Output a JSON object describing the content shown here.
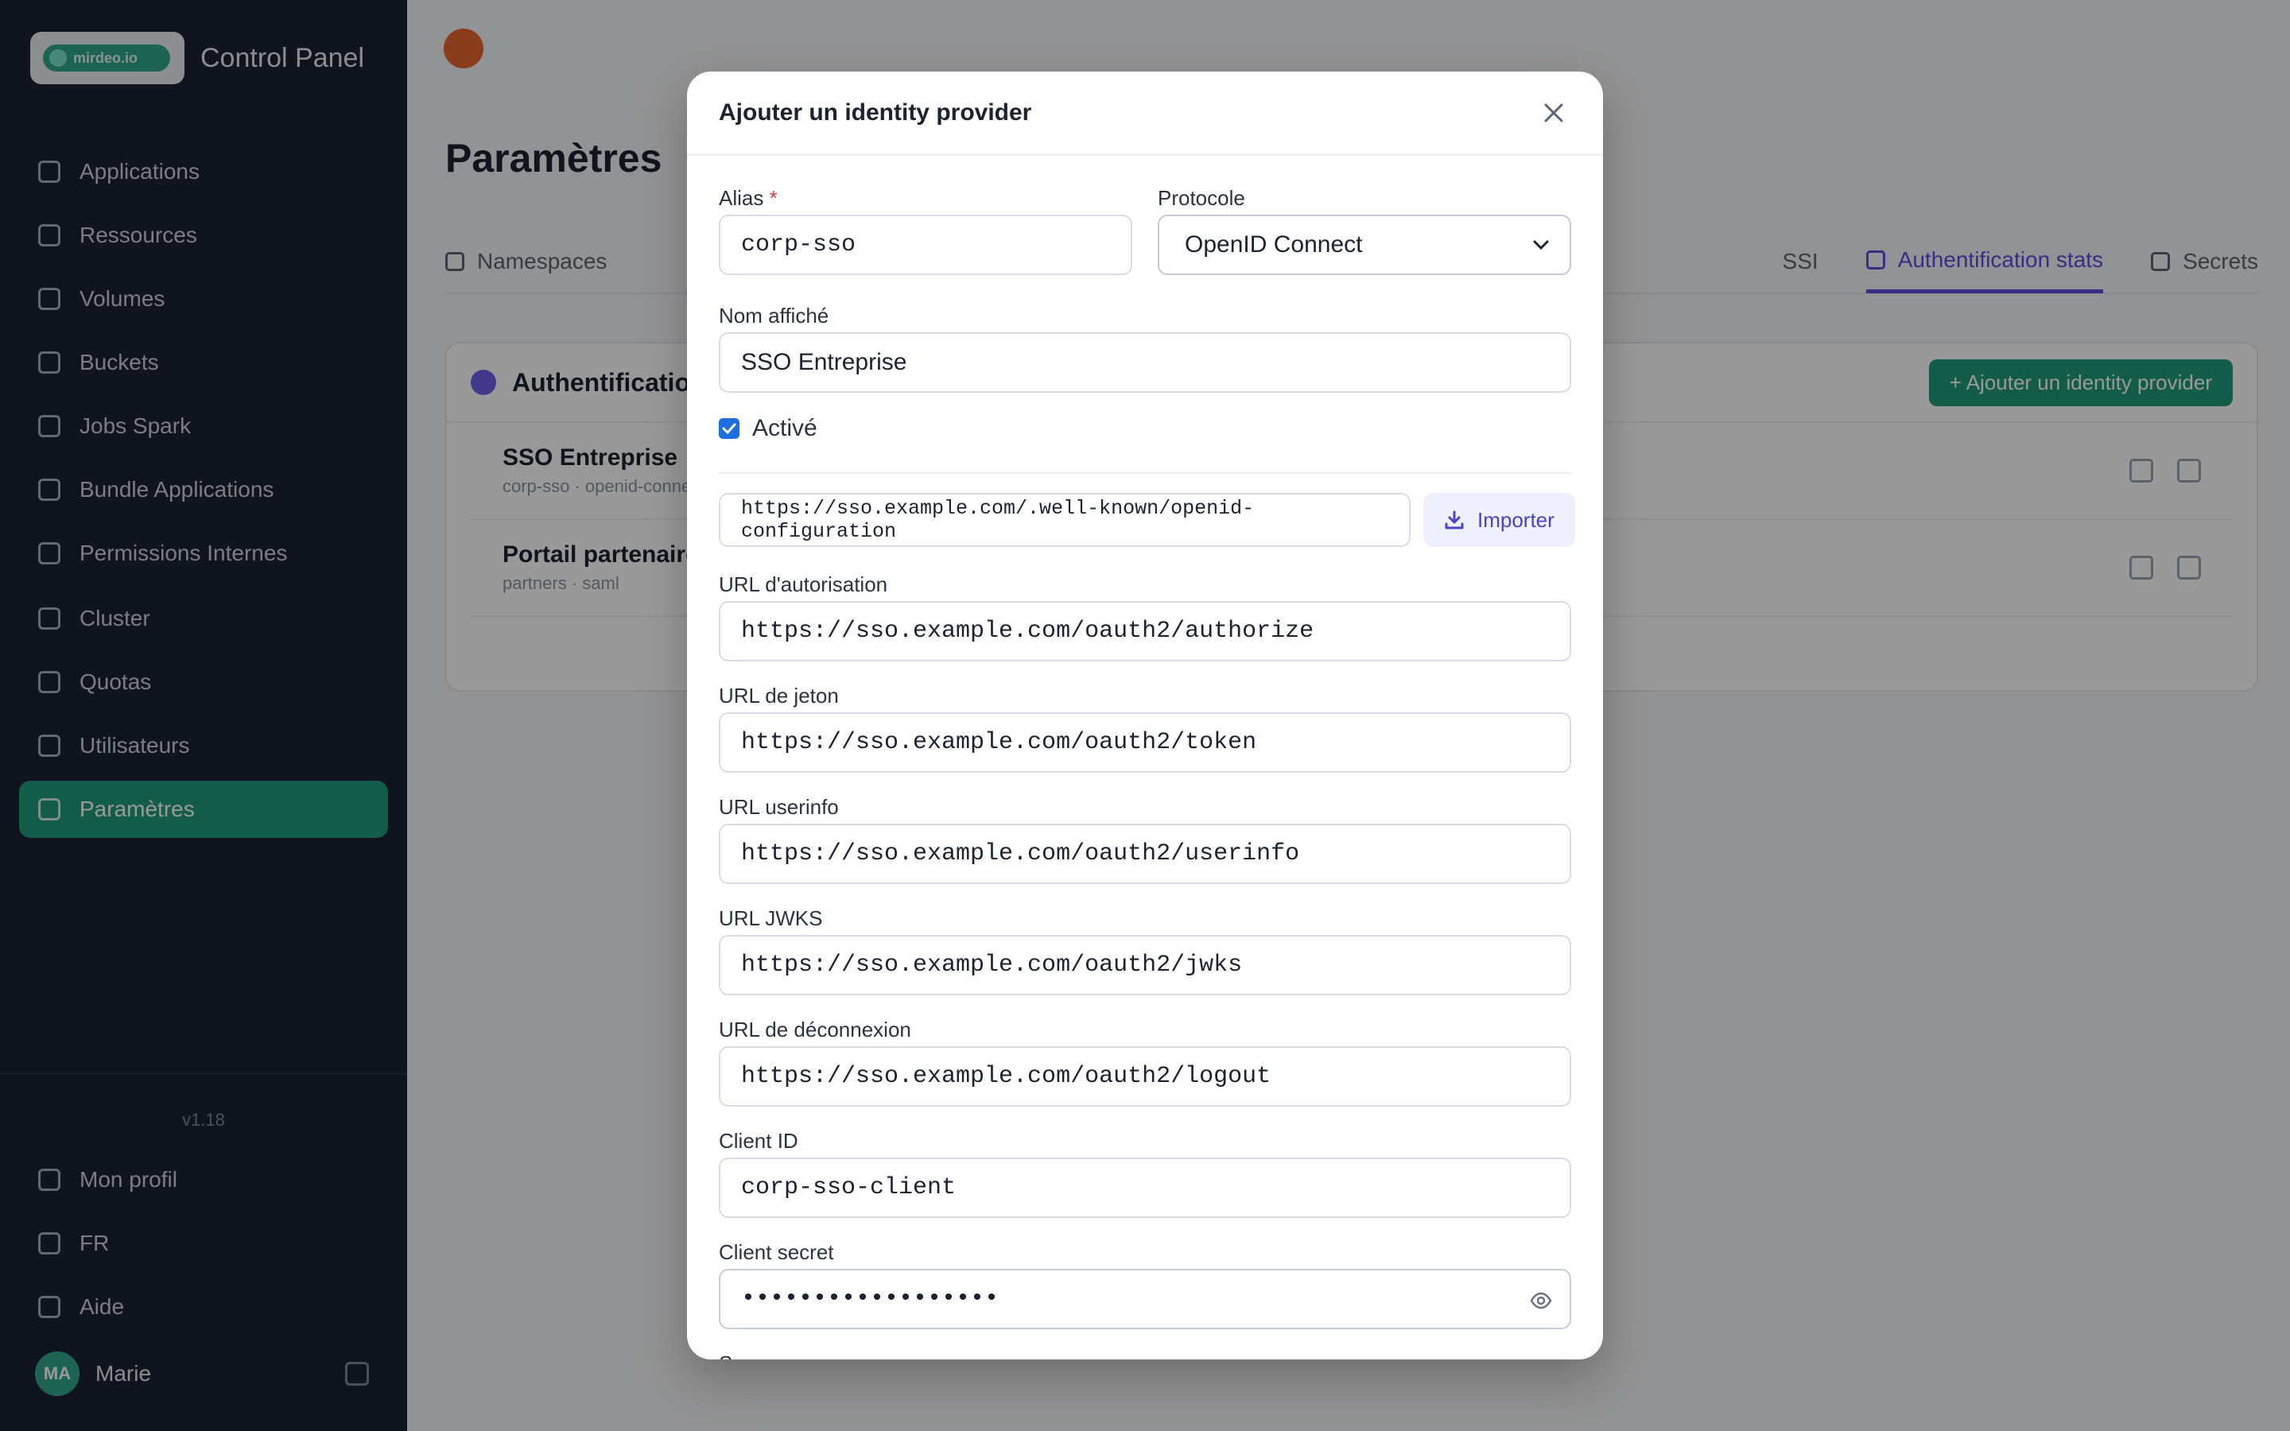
{
  "sidebar": {
    "brand_logo_text": "mirdeo.io",
    "brand_title": "Control Panel",
    "nav": [
      {
        "label": "Applications",
        "icon": "grid-icon"
      },
      {
        "label": "Ressources",
        "icon": "chart-icon"
      },
      {
        "label": "Volumes",
        "icon": "database-icon"
      },
      {
        "label": "Buckets",
        "icon": "bucket-icon"
      },
      {
        "label": "Jobs Spark",
        "icon": "bolt-icon"
      },
      {
        "label": "Bundle Applications",
        "icon": "package-icon"
      },
      {
        "label": "Permissions Internes",
        "icon": "shield-icon"
      },
      {
        "label": "Cluster",
        "icon": "server-icon"
      },
      {
        "label": "Quotas",
        "icon": "gauge-icon"
      },
      {
        "label": "Utilisateurs",
        "icon": "users-icon"
      },
      {
        "label": "Paramètres",
        "icon": "gear-icon"
      }
    ],
    "version": "v1.18",
    "bottom_nav": [
      {
        "label": "Mon profil",
        "icon": "user-icon"
      },
      {
        "label": "FR",
        "icon": "globe-icon"
      },
      {
        "label": "Aide",
        "icon": "help-icon"
      }
    ],
    "user_initials": "MA",
    "user_name": "Marie"
  },
  "main": {
    "page_title": "Paramètres",
    "tabs": [
      {
        "label": "Namespaces"
      },
      {
        "label": "SSI"
      },
      {
        "label": "Authentification stats"
      },
      {
        "label": "Secrets"
      }
    ],
    "card_title": "Authentification",
    "add_button": "+ Ajouter un identity provider",
    "providers": [
      {
        "name": "SSO Entreprise",
        "sub": "corp-sso · openid-connect"
      },
      {
        "name": "Portail partenaires",
        "sub": "partners · saml"
      }
    ]
  },
  "modal": {
    "title": "Ajouter un identity provider",
    "alias_label": "Alias",
    "alias_required": "*",
    "alias_value": "corp-sso",
    "protocol_label": "Protocole",
    "protocol_value": "OpenID Connect",
    "display_name_label": "Nom affiché",
    "display_name_value": "SSO Entreprise",
    "enabled_label": "Activé",
    "enabled": true,
    "discovery_url": "https://sso.example.com/.well-known/openid-configuration",
    "import_label": "Importer",
    "auth_url_label": "URL d'autorisation",
    "auth_url": "https://sso.example.com/oauth2/authorize",
    "token_url_label": "URL de jeton",
    "token_url": "https://sso.example.com/oauth2/token",
    "userinfo_url_label": "URL userinfo",
    "userinfo_url": "https://sso.example.com/oauth2/userinfo",
    "jwks_url_label": "URL JWKS",
    "jwks_url": "https://sso.example.com/oauth2/jwks",
    "logout_url_label": "URL de déconnexion",
    "logout_url": "https://sso.example.com/oauth2/logout",
    "client_id_label": "Client ID",
    "client_id": "corp-sso-client",
    "client_secret_label": "Client secret",
    "client_secret_masked": "••••••••••••••••••",
    "scopes_label": "Scopes"
  },
  "colors": {
    "accent": "#1f9a7b",
    "tab_active": "#5b4ee0",
    "import_text": "#4a42c8",
    "checkbox": "#1d6fe0"
  }
}
